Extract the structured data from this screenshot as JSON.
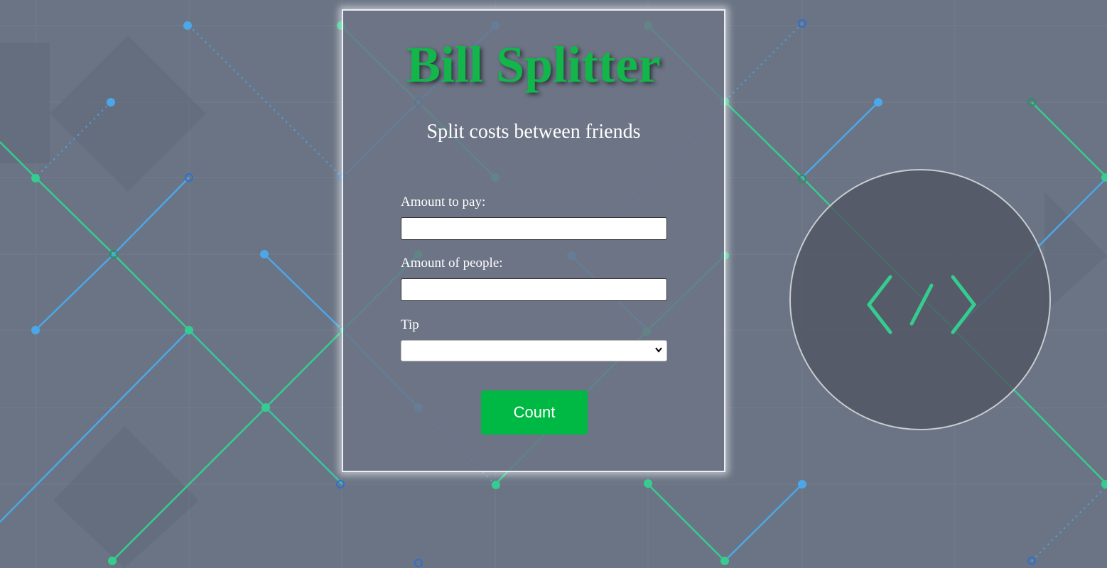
{
  "app": {
    "title": "Bill Splitter",
    "subtitle": "Split costs between friends"
  },
  "form": {
    "amount_label": "Amount to pay:",
    "amount_value": "",
    "people_label": "Amount of people:",
    "people_value": "",
    "tip_label": "Tip",
    "tip_selected": "",
    "submit_label": "Count"
  },
  "badge": {
    "icon": "code-icon"
  },
  "colors": {
    "title": "#12b64b",
    "button": "#00b944",
    "background": "#6b7484",
    "line_blue": "#4aa8e8",
    "line_green": "#35cc8f"
  }
}
